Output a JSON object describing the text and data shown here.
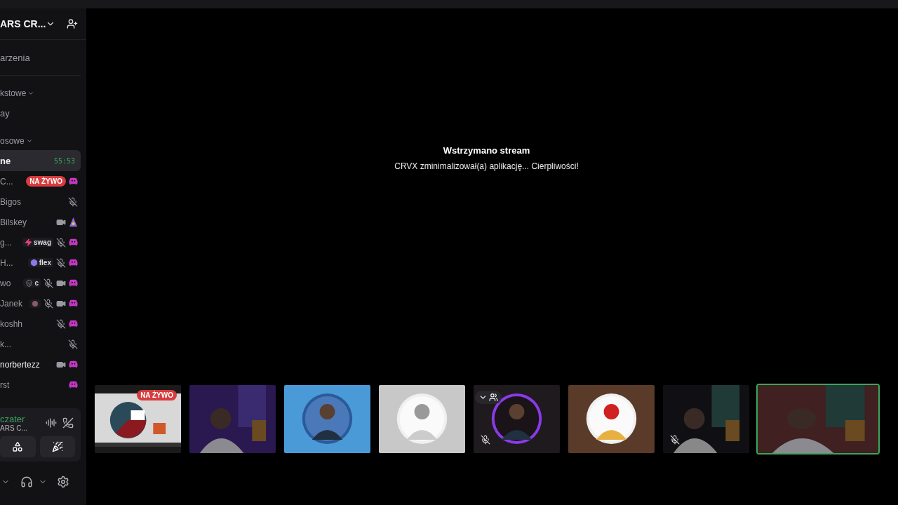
{
  "server": {
    "name": "ARS CR..."
  },
  "events": {
    "label": "arzenia"
  },
  "categories": [
    {
      "label": "kstowe",
      "expanded": true,
      "channels": [
        {
          "name": "ay",
          "selected": false
        }
      ]
    },
    {
      "label": "osowe",
      "expanded": true,
      "channels": [
        {
          "name": "ne",
          "selected": true,
          "timer": "55:53"
        }
      ]
    }
  ],
  "voice_users": [
    {
      "name": "C...",
      "badge": "NA ŻYWO",
      "muted": false,
      "camera": false,
      "activity": true
    },
    {
      "name": "Bigos",
      "muted": true,
      "camera": false,
      "activity": false
    },
    {
      "name": "Bilskey",
      "muted": false,
      "camera": true,
      "activity": false,
      "emoji": true
    },
    {
      "name": "g...",
      "muted": true,
      "camera": false,
      "activity": true,
      "tag": {
        "kind": "bolt",
        "label": "swag"
      }
    },
    {
      "name": "H...",
      "muted": true,
      "camera": false,
      "activity": true,
      "tag": {
        "kind": "hex",
        "label": "flex"
      }
    },
    {
      "name": "wo",
      "muted": true,
      "camera": true,
      "activity": true,
      "tag": {
        "kind": "skull",
        "label": "c"
      }
    },
    {
      "name": "Janek",
      "muted": true,
      "camera": true,
      "activity": true,
      "tag": {
        "kind": "blob"
      }
    },
    {
      "name": "koshh",
      "muted": true,
      "camera": false,
      "activity": true
    },
    {
      "name": "k...",
      "muted": true,
      "camera": false,
      "activity": false
    },
    {
      "name": "norbertezz",
      "muted": false,
      "camera": true,
      "activity": true,
      "bright": true
    },
    {
      "name": "rst",
      "muted": false,
      "camera": false,
      "activity": true
    }
  ],
  "voice_panel": {
    "user": "czater",
    "server": "ARS C..."
  },
  "stream": {
    "title": "Wstrzymano stream",
    "message": "CRVX zminimalizował(a) aplikację... Cierpliwości!"
  },
  "tiles": [
    {
      "kind": "stream",
      "badge": "NA ŻYWO",
      "muted": false,
      "speaking": false,
      "overlay": false
    },
    {
      "kind": "camera",
      "muted": false,
      "speaking": false,
      "overlay": false
    },
    {
      "kind": "avatar",
      "muted": false,
      "speaking": false,
      "overlay": false
    },
    {
      "kind": "avatar",
      "muted": false,
      "speaking": false,
      "overlay": false
    },
    {
      "kind": "avatar",
      "muted": true,
      "speaking": false,
      "overlay": true
    },
    {
      "kind": "avatar",
      "muted": false,
      "speaking": false,
      "overlay": false
    },
    {
      "kind": "camera",
      "muted": true,
      "speaking": false,
      "overlay": false
    },
    {
      "kind": "camera",
      "muted": false,
      "speaking": true,
      "overlay": false
    }
  ]
}
